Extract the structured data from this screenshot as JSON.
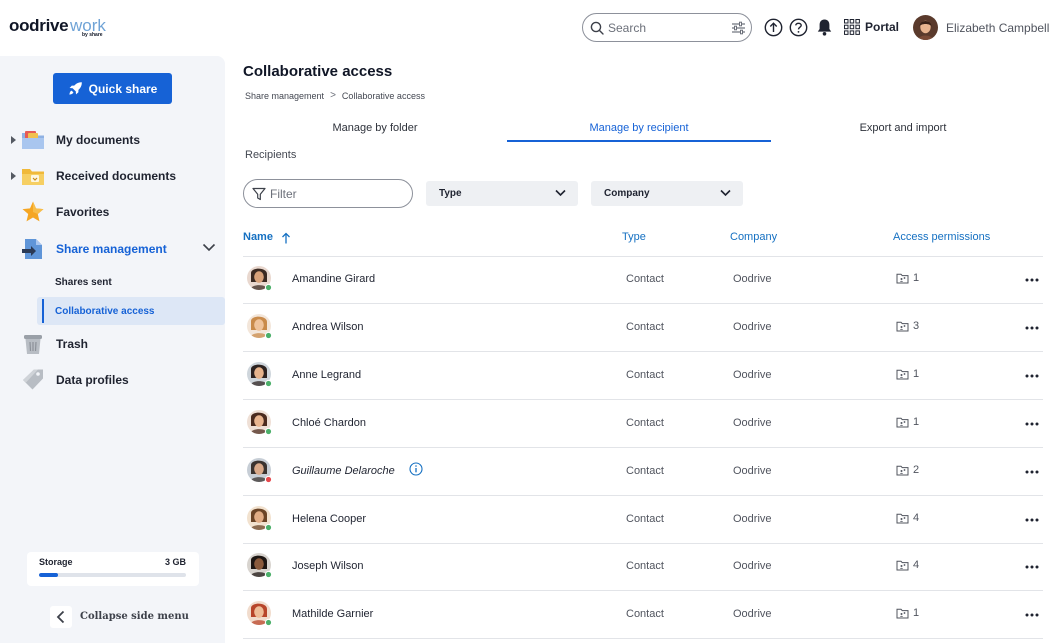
{
  "header": {
    "logo_main": "oodrive",
    "logo_accent": "work",
    "logo_sub": "by share",
    "search_placeholder": "Search",
    "portal_label": "Portal",
    "user_name": "Elizabeth Campbell",
    "icons": [
      "upload-icon",
      "help-icon",
      "bell-icon",
      "apps-grid-icon",
      "filter-settings-icon",
      "search-icon"
    ]
  },
  "sidebar": {
    "quick_share_label": "Quick share",
    "items": [
      {
        "label": "My documents",
        "icon": "folder-icon",
        "expandable": true
      },
      {
        "label": "Received documents",
        "icon": "inbox-folder-icon",
        "expandable": true
      },
      {
        "label": "Favorites",
        "icon": "star-icon",
        "expandable": false
      },
      {
        "label": "Share management",
        "icon": "share-management-icon",
        "expandable": true,
        "expanded": true,
        "active": true
      },
      {
        "label": "Trash",
        "icon": "trash-icon",
        "expandable": false
      },
      {
        "label": "Data profiles",
        "icon": "tag-icon",
        "expandable": false
      }
    ],
    "sub_items": [
      {
        "label": "Shares sent",
        "active": false
      },
      {
        "label": "Collaborative access",
        "active": true
      }
    ],
    "storage": {
      "label": "Storage",
      "value": "3 GB",
      "used_fraction": 0.13
    },
    "collapse_label": "Collapse side menu"
  },
  "main": {
    "title": "Collaborative access",
    "breadcrumb": [
      "Share management",
      "Collaborative access"
    ],
    "breadcrumb_sep": ">",
    "tabs": [
      {
        "label": "Manage by folder",
        "active": false
      },
      {
        "label": "Manage by recipient",
        "active": true
      },
      {
        "label": "Export and import",
        "active": false
      }
    ],
    "section_label": "Recipients",
    "filter_placeholder": "Filter",
    "dropdowns": [
      {
        "label": "Type"
      },
      {
        "label": "Company"
      }
    ],
    "columns": {
      "name": "Name",
      "type": "Type",
      "company": "Company",
      "access": "Access permissions"
    },
    "colors": {
      "accent": "#1662d6",
      "header_text": "#1570c2",
      "online": "#4caf6a",
      "offline": "#e5484d"
    },
    "rows": [
      {
        "name": "Amandine Girard",
        "type": "Contact",
        "company": "Oodrive",
        "access": "1",
        "status": "online",
        "italic": false,
        "info": false,
        "skin": "#d9a27a",
        "hair": "#3b2a22",
        "bg": "#e9d8cf"
      },
      {
        "name": "Andrea Wilson",
        "type": "Contact",
        "company": "Oodrive",
        "access": "3",
        "status": "online",
        "italic": false,
        "info": false,
        "skin": "#f0c49c",
        "hair": "#c98b4b",
        "bg": "#f3e6da"
      },
      {
        "name": "Anne Legrand",
        "type": "Contact",
        "company": "Oodrive",
        "access": "1",
        "status": "online",
        "italic": false,
        "info": false,
        "skin": "#e6b38c",
        "hair": "#2c2220",
        "bg": "#cfd6dc"
      },
      {
        "name": "Chloé Chardon",
        "type": "Contact",
        "company": "Oodrive",
        "access": "1",
        "status": "online",
        "italic": false,
        "info": false,
        "skin": "#e9b58f",
        "hair": "#4b2b1e",
        "bg": "#efe0d6"
      },
      {
        "name": "Guillaume Delaroche",
        "type": "Contact",
        "company": "Oodrive",
        "access": "2",
        "status": "offline",
        "italic": true,
        "info": true,
        "skin": "#d9a98a",
        "hair": "#3a3330",
        "bg": "#c7ced6"
      },
      {
        "name": "Helena Cooper",
        "type": "Contact",
        "company": "Oodrive",
        "access": "4",
        "status": "online",
        "italic": false,
        "info": false,
        "skin": "#e2ad85",
        "hair": "#6b4426",
        "bg": "#f2e2cf"
      },
      {
        "name": "Joseph Wilson",
        "type": "Contact",
        "company": "Oodrive",
        "access": "4",
        "status": "online",
        "italic": false,
        "info": false,
        "skin": "#8a5a3c",
        "hair": "#1d1613",
        "bg": "#d8d4cf"
      },
      {
        "name": "Mathilde Garnier",
        "type": "Contact",
        "company": "Oodrive",
        "access": "1",
        "status": "online",
        "italic": false,
        "info": false,
        "skin": "#efbd98",
        "hair": "#b8452a",
        "bg": "#f1dccd"
      }
    ]
  }
}
